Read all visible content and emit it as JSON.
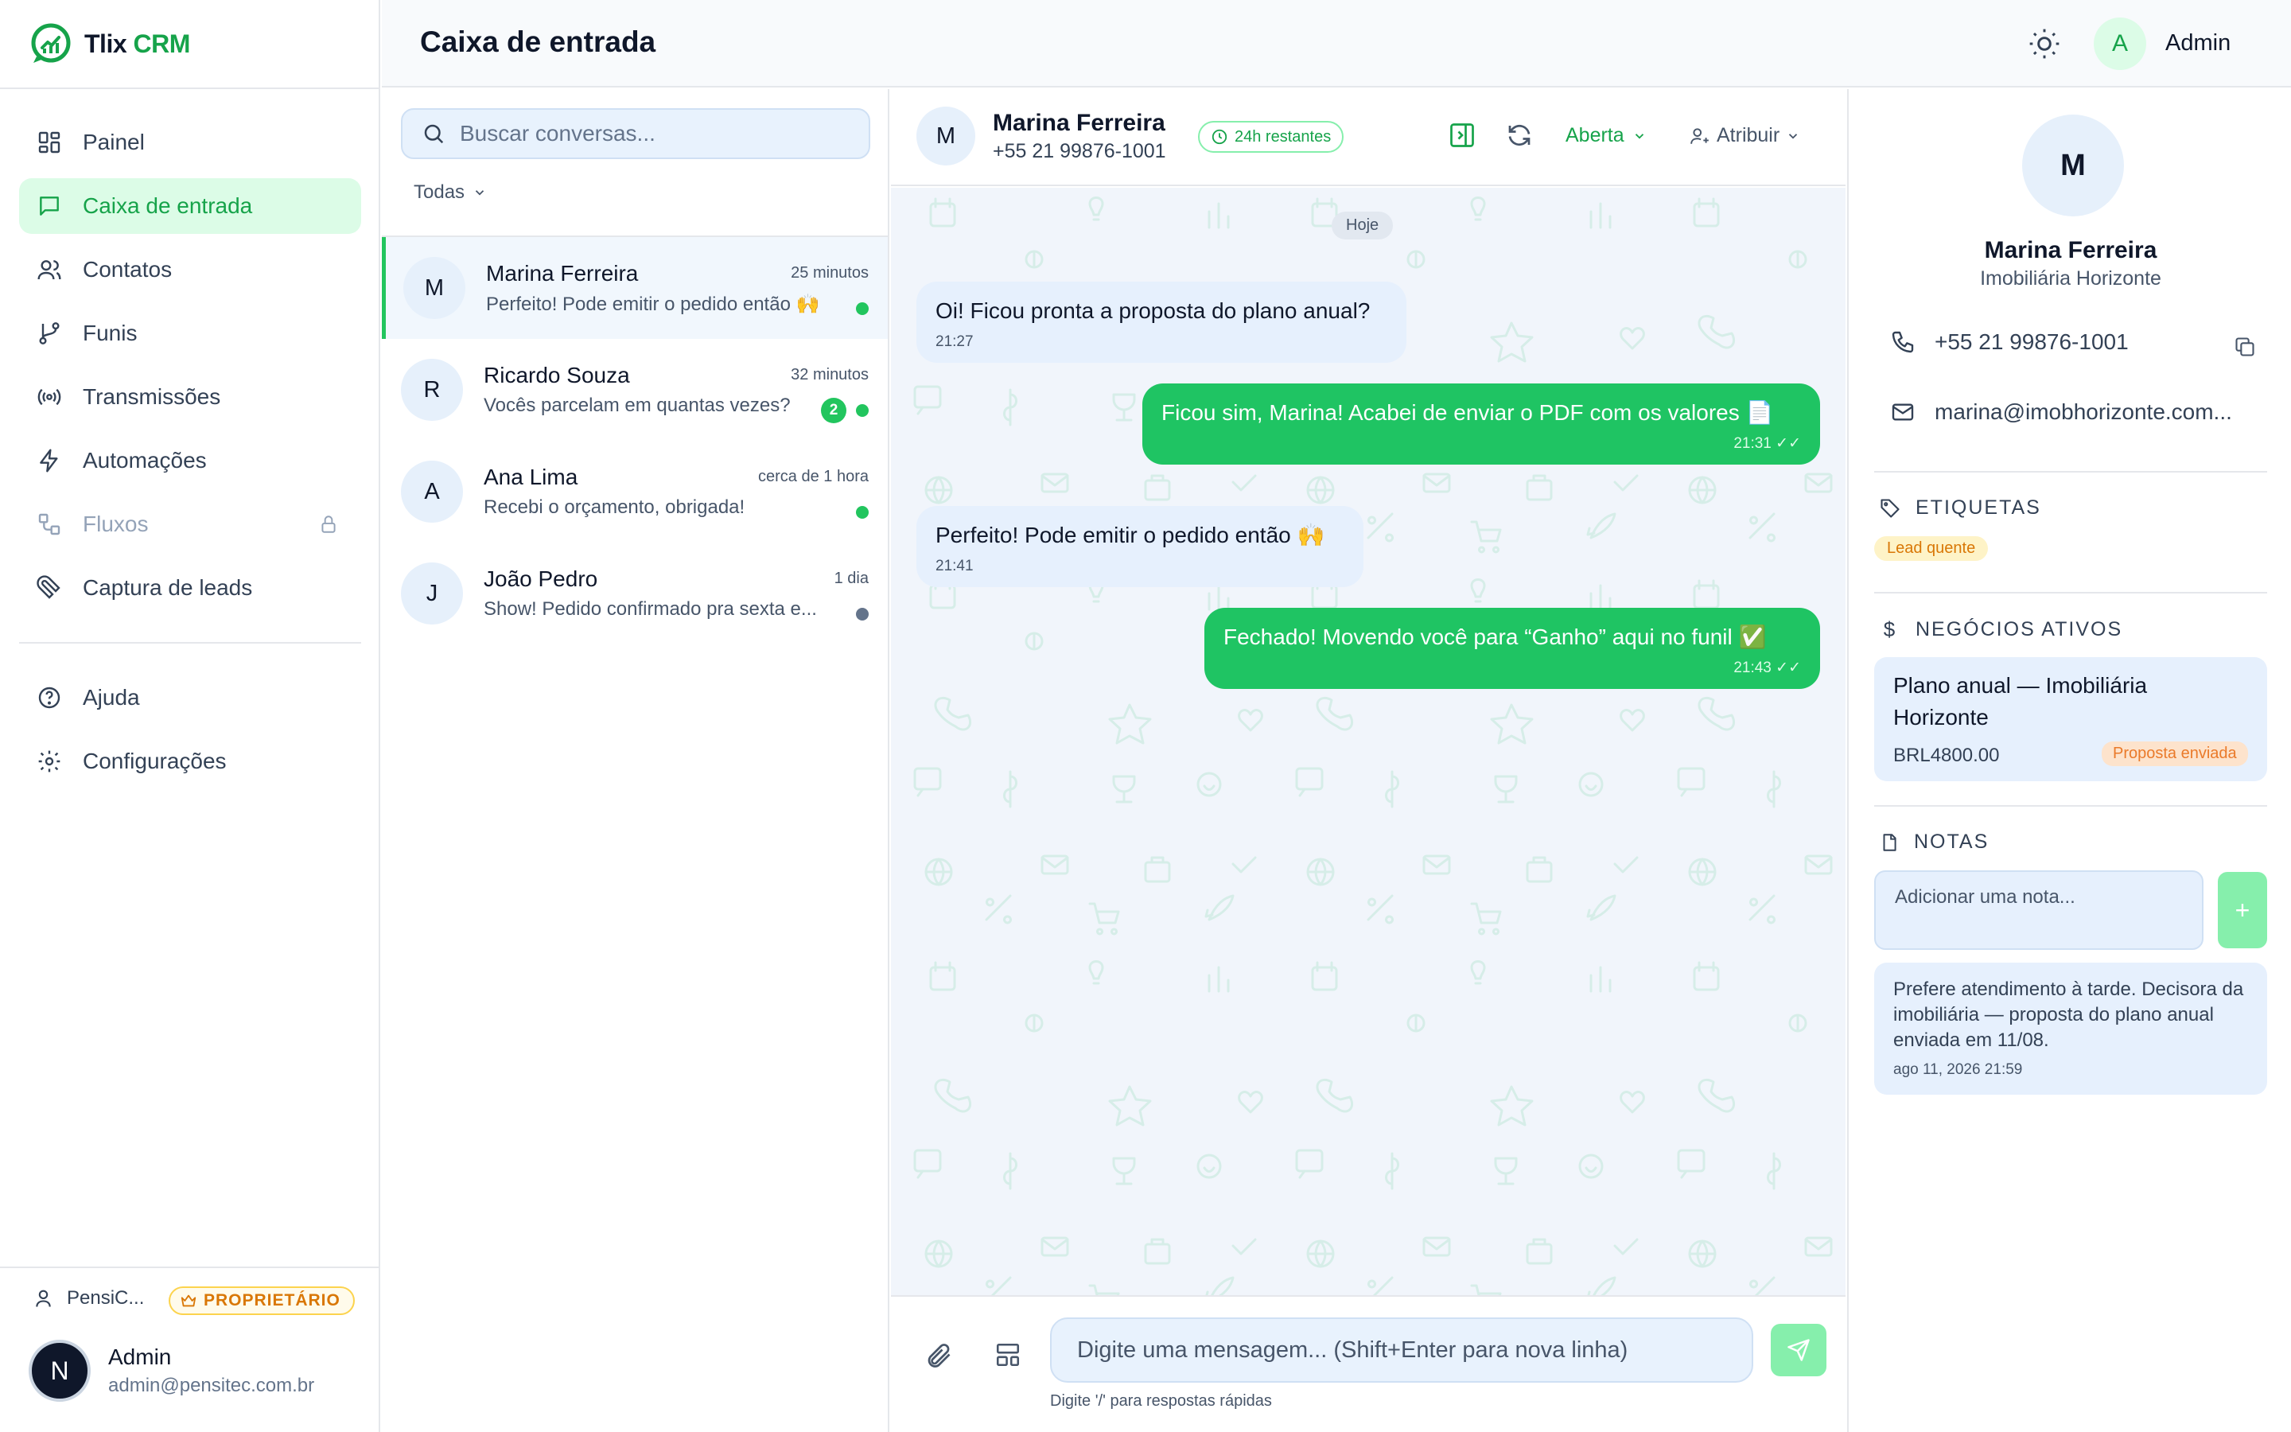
{
  "brand": {
    "name_part1": "Tlix",
    "name_part2": "CRM",
    "accent": "#16a34a"
  },
  "sidebar": {
    "items": [
      {
        "label": "Painel",
        "icon": "dashboard-icon"
      },
      {
        "label": "Caixa de entrada",
        "icon": "message-icon",
        "active": true
      },
      {
        "label": "Contatos",
        "icon": "users-icon"
      },
      {
        "label": "Funis",
        "icon": "git-branch-icon"
      },
      {
        "label": "Transmissões",
        "icon": "broadcast-icon"
      },
      {
        "label": "Automações",
        "icon": "lightning-icon"
      },
      {
        "label": "Fluxos",
        "icon": "workflow-icon",
        "locked": true
      },
      {
        "label": "Captura de leads",
        "icon": "magnet-icon"
      }
    ],
    "secondary": [
      {
        "label": "Ajuda",
        "icon": "help-icon"
      },
      {
        "label": "Configurações",
        "icon": "gear-icon"
      }
    ],
    "org": {
      "name": "PensiC...",
      "role": "PROPRIETÁRIO"
    },
    "user": {
      "initial": "N",
      "name": "Admin",
      "email": "admin@pensitec.com.br"
    }
  },
  "header": {
    "title": "Caixa de entrada",
    "user_initial": "A",
    "user_name": "Admin"
  },
  "convlist": {
    "search_placeholder": "Buscar conversas...",
    "filter": "Todas",
    "items": [
      {
        "initial": "M",
        "name": "Marina Ferreira",
        "time": "25 minutos",
        "preview": "Perfeito! Pode emitir o pedido então 🙌",
        "status": "online",
        "active": true
      },
      {
        "initial": "R",
        "name": "Ricardo Souza",
        "time": "32 minutos",
        "preview": "Vocês parcelam em quantas vezes?",
        "unread": "2",
        "status": "online"
      },
      {
        "initial": "A",
        "name": "Ana Lima",
        "time": "cerca de 1 hora",
        "preview": "Recebi o orçamento, obrigada!",
        "status": "online"
      },
      {
        "initial": "J",
        "name": "João Pedro",
        "time": "1 dia",
        "preview": "Show! Pedido confirmado pra sexta e...",
        "status": "offline"
      }
    ]
  },
  "chat": {
    "contact_initial": "M",
    "contact_name": "Marina Ferreira",
    "contact_phone": "+55 21 99876-1001",
    "window_badge": "24h restantes",
    "status": "Aberta",
    "assign": "Atribuir",
    "day_label": "Hoje",
    "messages": [
      {
        "dir": "in",
        "text": "Oi! Ficou pronta a proposta do plano anual?",
        "time": "21:27"
      },
      {
        "dir": "out",
        "text": "Ficou sim, Marina! Acabei de enviar o PDF com os valores 📄",
        "time": "21:31"
      },
      {
        "dir": "in",
        "text": "Perfeito! Pode emitir o pedido então 🙌",
        "time": "21:41"
      },
      {
        "dir": "out",
        "text": "Fechado! Movendo você para “Ganho” aqui no funil ✅",
        "time": "21:43"
      }
    ],
    "composer_placeholder": "Digite uma mensagem... (Shift+Enter para nova linha)",
    "composer_hint": "Digite '/' para respostas rápidas"
  },
  "details": {
    "initial": "M",
    "name": "Marina Ferreira",
    "company": "Imobiliária Horizonte",
    "phone": "+55 21 99876-1001",
    "email": "marina@imobhorizonte.com...",
    "tags_title": "ETIQUETAS",
    "tags": [
      "Lead quente"
    ],
    "deals_title": "NEGÓCIOS ATIVOS",
    "deal": {
      "title": "Plano anual — Imobiliária Horizonte",
      "value": "BRL4800.00",
      "stage": "Proposta enviada"
    },
    "notes_title": "NOTAS",
    "note_placeholder": "Adicionar uma nota...",
    "note_add_label": "+",
    "notes": [
      {
        "text": "Prefere atendimento à tarde. Decisora da imobiliária — proposta do plano anual enviada em 11/08.",
        "date": "ago 11, 2026 21:59"
      }
    ]
  }
}
